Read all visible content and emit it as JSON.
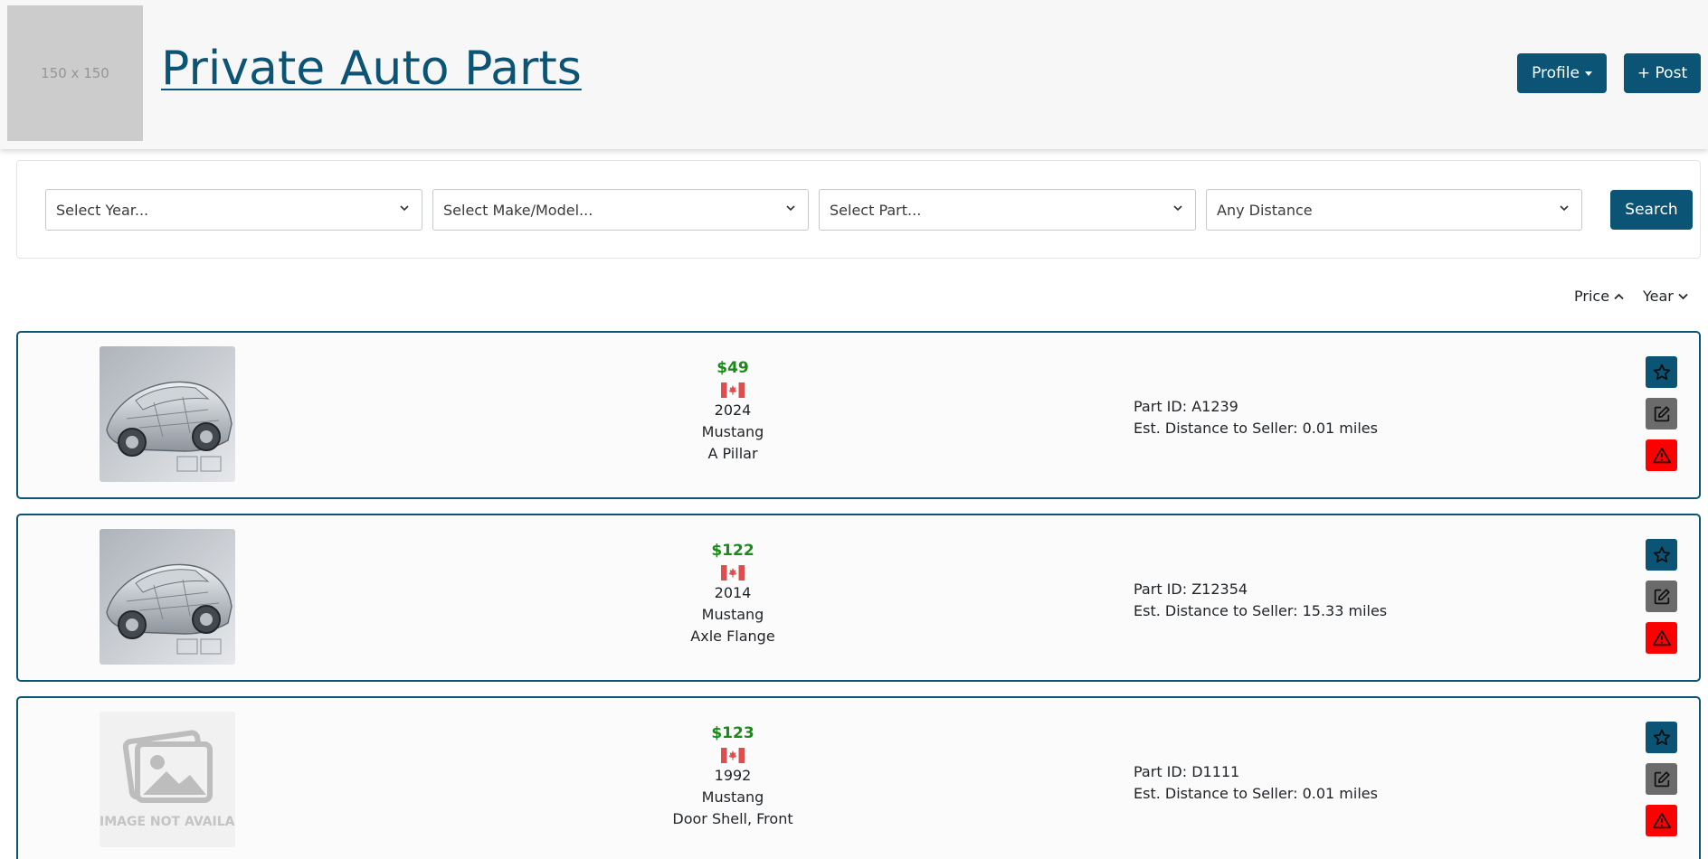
{
  "header": {
    "logo_text": "150 x 150",
    "site_title": "Private Auto Parts",
    "profile_label": "Profile",
    "post_label": "+ Post"
  },
  "filters": {
    "year": "Select Year...",
    "make_model": "Select Make/Model...",
    "part": "Select Part...",
    "distance": "Any Distance",
    "search_label": "Search"
  },
  "sort": {
    "price_label": "Price",
    "price_direction": "asc",
    "year_label": "Year",
    "year_direction": "desc"
  },
  "listings": [
    {
      "image": "car-cutaway",
      "price": "$49",
      "country": "Canada",
      "year": "2024",
      "model": "Mustang",
      "part": "A Pillar",
      "part_id": "Part ID: A1239",
      "distance": "Est. Distance to Seller: 0.01 miles"
    },
    {
      "image": "car-cutaway",
      "price": "$122",
      "country": "Canada",
      "year": "2014",
      "model": "Mustang",
      "part": "Axle Flange",
      "part_id": "Part ID: Z12354",
      "distance": "Est. Distance to Seller: 15.33 miles"
    },
    {
      "image": "image-not-available",
      "image_text": "IMAGE NOT AVAILABLE",
      "price": "$123",
      "country": "Canada",
      "year": "1992",
      "model": "Mustang",
      "part": "Door Shell, Front",
      "part_id": "Part ID: D1111",
      "distance": "Est. Distance to Seller: 0.01 miles"
    }
  ],
  "icons": {
    "favorite": "star-icon",
    "edit": "edit-icon",
    "report": "warning-icon",
    "flag": "canada-flag-icon"
  },
  "colors": {
    "primary": "#0b5475",
    "price": "#1b8a1b",
    "report": "#ff0000",
    "edit": "#6b6b6b"
  }
}
